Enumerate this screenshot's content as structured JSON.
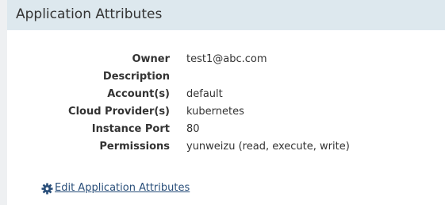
{
  "panel": {
    "title": "Application Attributes"
  },
  "attributes": [
    {
      "label": "Owner",
      "value": "test1@abc.com"
    },
    {
      "label": "Description",
      "value": ""
    },
    {
      "label": "Account(s)",
      "value": "default"
    },
    {
      "label": "Cloud Provider(s)",
      "value": "kubernetes"
    },
    {
      "label": "Instance Port",
      "value": "80"
    },
    {
      "label": "Permissions",
      "value": "yunweizu (read, execute, write)"
    }
  ],
  "edit_link": {
    "icon": "gear-icon",
    "label": "Edit Application Attributes"
  },
  "colors": {
    "header_bg": "#dde8ee",
    "link": "#2a4f7a",
    "text": "#333333"
  }
}
